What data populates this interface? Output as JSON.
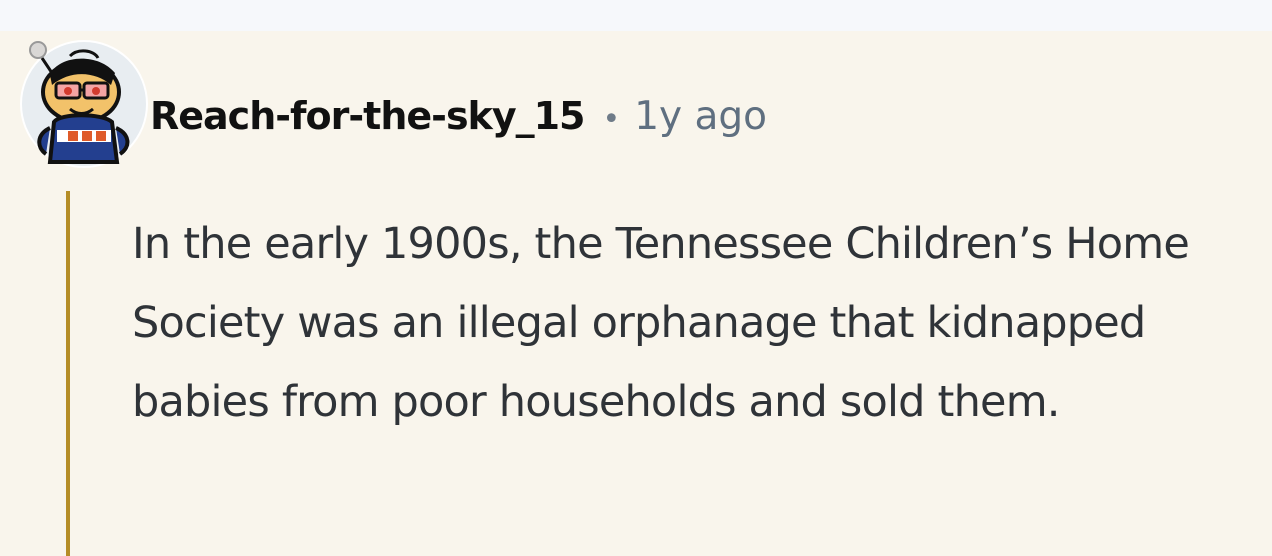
{
  "comment": {
    "author": "Reach-for-the-sky_15",
    "separator": "•",
    "timestamp": "1y ago",
    "body": "In the early 1900s, the Tennessee Children’s Home Society was an illegal orphanage that kidnapped babies from poor households and sold them."
  },
  "icons": {
    "avatar": "snoo-avatar-icon"
  },
  "colors": {
    "page_background": "#f6f8fb",
    "card_background": "#f9f5ec",
    "thread_line": "#b58d26",
    "author": "#111111",
    "timestamp": "#5f6f80",
    "body_text": "#2f3338"
  }
}
